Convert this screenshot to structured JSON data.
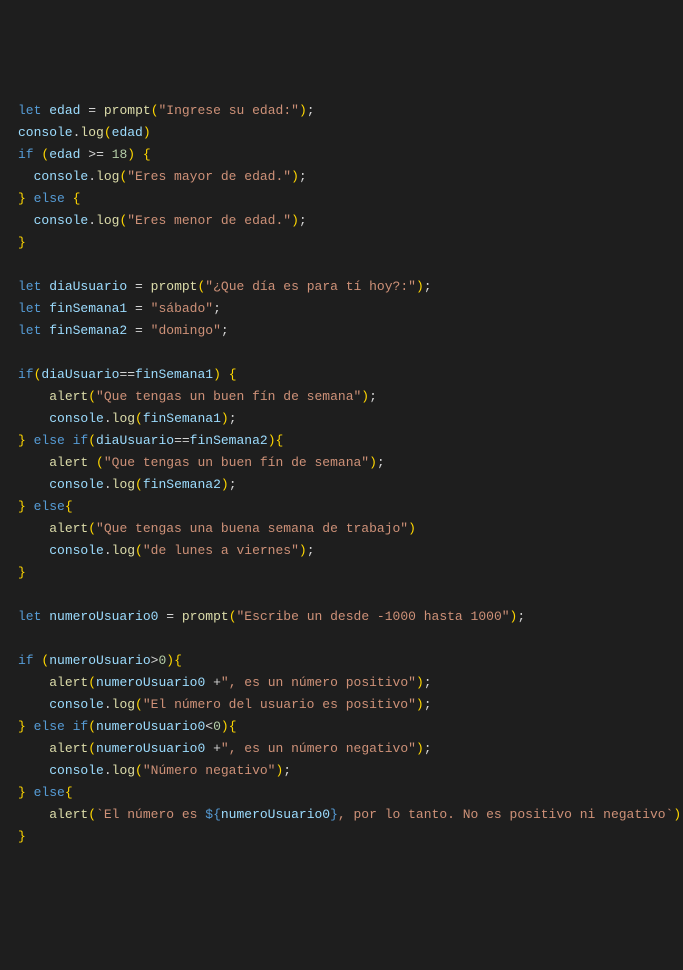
{
  "code": {
    "l1": {
      "kw": "let",
      "var": "edad",
      "fn": "prompt",
      "str": "\"Ingrese su edad:\""
    },
    "l2": {
      "obj": "console",
      "fn": "log",
      "var": "edad"
    },
    "l3": {
      "kw": "if",
      "var": "edad",
      "num": "18"
    },
    "l4": {
      "obj": "console",
      "fn": "log",
      "str": "\"Eres mayor de edad.\""
    },
    "l5": {
      "kw": "else"
    },
    "l6": {
      "obj": "console",
      "fn": "log",
      "str": "\"Eres menor de edad.\""
    },
    "l9": {
      "kw": "let",
      "var": "diaUsuario",
      "fn": "prompt",
      "str": "\"¿Que día es para tí hoy?:\""
    },
    "l10": {
      "kw": "let",
      "var": "finSemana1",
      "str": "\"sábado\""
    },
    "l11": {
      "kw": "let",
      "var": "finSemana2",
      "str": "\"domingo\""
    },
    "l13": {
      "kw": "if",
      "v1": "diaUsuario",
      "v2": "finSemana1"
    },
    "l14": {
      "fn": "alert",
      "str": "\"Que tengas un buen fín de semana\""
    },
    "l15": {
      "obj": "console",
      "fn": "log",
      "var": "finSemana1"
    },
    "l16": {
      "kw": "else if",
      "v1": "diaUsuario",
      "v2": "finSemana2"
    },
    "l17": {
      "fn": "alert",
      "str": "\"Que tengas un buen fín de semana\""
    },
    "l18": {
      "obj": "console",
      "fn": "log",
      "var": "finSemana2"
    },
    "l19": {
      "kw": "else"
    },
    "l20": {
      "fn": "alert",
      "str": "\"Que tengas una buena semana de trabajo\""
    },
    "l21": {
      "obj": "console",
      "fn": "log",
      "str": "\"de lunes a viernes\""
    },
    "l24": {
      "kw": "let",
      "var": "numeroUsuario0",
      "fn": "prompt",
      "str": "\"Escribe un desde -1000 hasta 1000\""
    },
    "l26": {
      "kw": "if",
      "var": "numeroUsuario",
      "num": "0"
    },
    "l27": {
      "fn": "alert",
      "var": "numeroUsuario0",
      "str": "\", es un número positivo\""
    },
    "l28": {
      "obj": "console",
      "fn": "log",
      "str": "\"El número del usuario es positivo\""
    },
    "l29": {
      "kw": "else if",
      "var": "numeroUsuario0",
      "num": "0"
    },
    "l30": {
      "fn": "alert",
      "var": "numeroUsuario0",
      "str": "\", es un número negativo\""
    },
    "l31": {
      "obj": "console",
      "fn": "log",
      "str": "\"Número negativo\""
    },
    "l32": {
      "kw": "else"
    },
    "l33": {
      "fn": "alert",
      "s1": "`El número es ",
      "tpl": "numeroUsuario0",
      "s2": ", por lo tanto. No es positivo ni negativo`"
    }
  }
}
